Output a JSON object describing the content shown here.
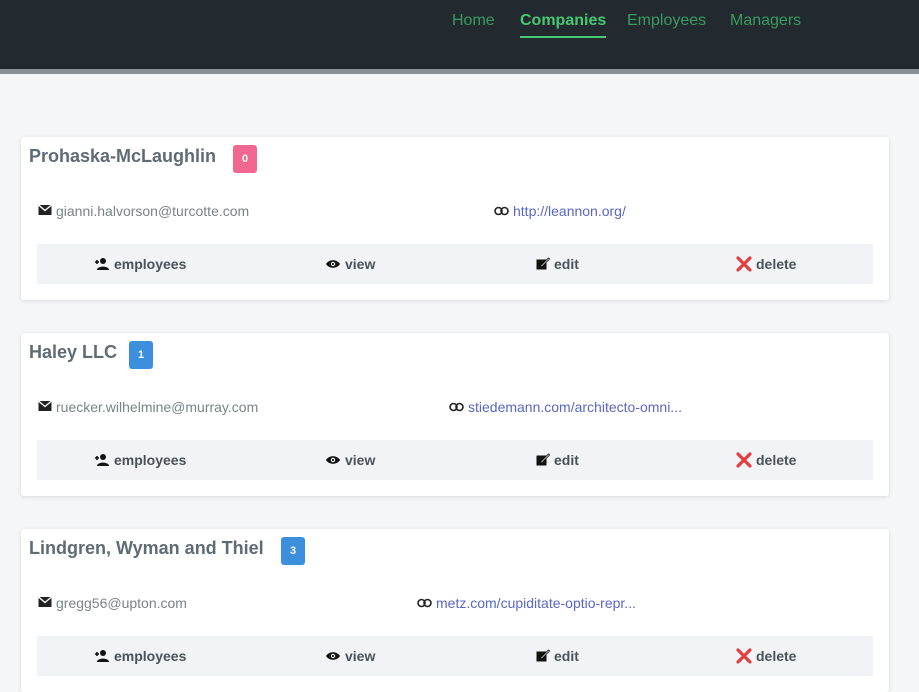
{
  "nav": {
    "items": [
      {
        "label": "Home",
        "active": false
      },
      {
        "label": "Companies",
        "active": true
      },
      {
        "label": "Employees",
        "active": false
      },
      {
        "label": "Managers",
        "active": false
      }
    ]
  },
  "colors": {
    "navbar_bg": "#222a30",
    "nav_active": "#48c774",
    "badge_pink": "#f1678f",
    "badge_blue": "#3c8fdc",
    "delete_red": "#e53c3c",
    "link": "#5a67c6"
  },
  "actions": {
    "employees": "employees",
    "view": "view",
    "edit": "edit",
    "delete": "delete"
  },
  "companies": [
    {
      "name": "Prohaska-McLaughlin",
      "count": "0",
      "badge_color": "#f1678f",
      "email": "gianni.halvorson@turcotte.com",
      "website": "http://leannon.org/"
    },
    {
      "name": "Haley LLC",
      "count": "1",
      "badge_color": "#3c8fdc",
      "email": "ruecker.wilhelmine@murray.com",
      "website": "stiedemann.com/architecto-omni..."
    },
    {
      "name": "Lindgren, Wyman and Thiel",
      "count": "3",
      "badge_color": "#3c8fdc",
      "email": "gregg56@upton.com",
      "website": "metz.com/cupiditate-optio-repr..."
    }
  ],
  "icons": {
    "email": "envelope-icon",
    "website": "link-icon",
    "employees": "user-plus-icon",
    "view": "eye-icon",
    "edit": "edit-icon",
    "delete": "x-icon"
  }
}
